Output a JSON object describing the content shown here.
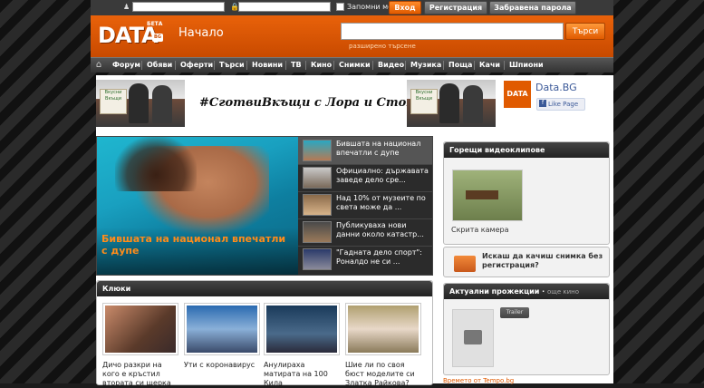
{
  "login": {
    "username_placeholder": "",
    "password_placeholder": "",
    "remember_label": "Запомни ме",
    "login_button": "Вход",
    "register_button": "Регистрация",
    "forgot_button": "Забравена парола"
  },
  "header": {
    "logo_text": "DATA",
    "logo_beta": "БЕТА",
    "logo_bg": "BG",
    "page_title": "Начало",
    "search_button": "Търси",
    "advanced_search": "разширено търсене"
  },
  "nav": {
    "items": [
      "Форум",
      "Обяви",
      "Оферти",
      "Търси",
      "Новини",
      "ТВ",
      "Кино",
      "Снимки",
      "Видео",
      "Музика",
      "Поща",
      "Качи",
      "Шпиони"
    ]
  },
  "banner": {
    "hashtag": "#СготвиВкъщи с Лора и Стоян",
    "sign_text": "Вкусни Вкъщи",
    "fb_name": "Data.BG",
    "fb_logo": "DATA",
    "fb_like": "Like Page"
  },
  "featured": {
    "caption": "Бившата на национал впечатли с дупе",
    "items": [
      "Бившата на национал впечатли с дупе",
      "Официално: държавата заведе дело сре...",
      "Над 10% от музеите по света може да ...",
      "Публикуваха нови данни около катастр...",
      "\"Гадната дело спорт\": Роналдо не си ..."
    ]
  },
  "right": {
    "hot_videos_title": "Горещи видеоклипове",
    "video_label": "Скрита камера",
    "upload_text": "Искаш да качиш снимка без регистрация?",
    "projections_title": "Актуални прожекции",
    "projections_more": "още кино",
    "projections_button": "Trailer",
    "weather": "Времето от Tempo.bg"
  },
  "gossip": {
    "title": "Клюки",
    "items": [
      "Дичо разкри на кого е кръстил втората си щерка",
      "Ути с коронавирус",
      "Анулираха матирата на 100 Кила",
      "Шие ли по своя бюст моделите си Златка Райкова?"
    ]
  },
  "colors": {
    "accent": "#e05a00",
    "header_orange": "#e9620a",
    "feature_caption": "#ff8c1a"
  }
}
